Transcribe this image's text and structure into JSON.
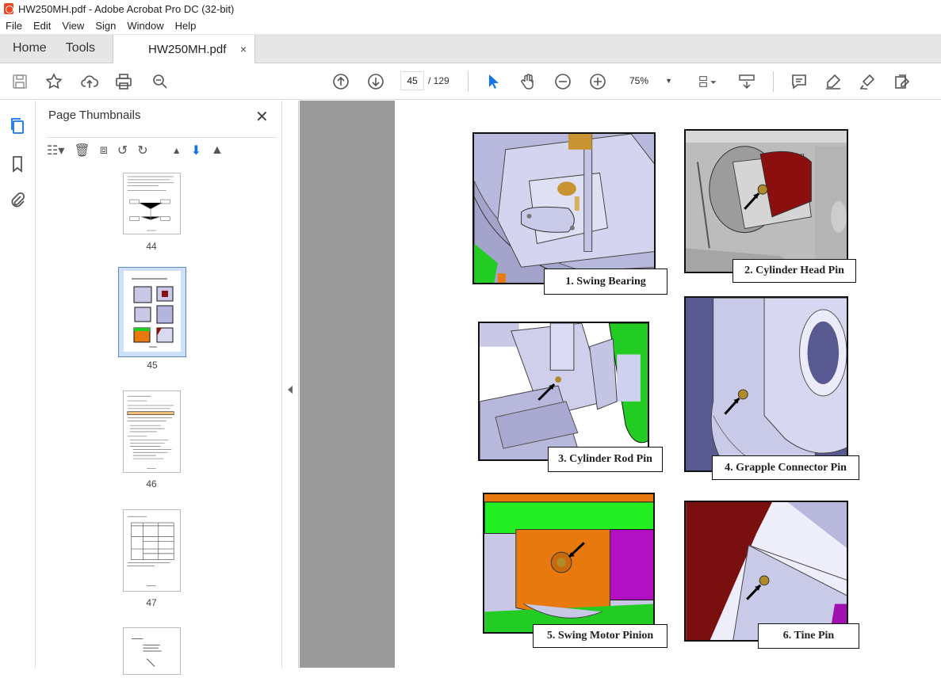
{
  "window": {
    "title": "HW250MH.pdf - Adobe Acrobat Pro DC (32-bit)"
  },
  "menu": [
    "File",
    "Edit",
    "View",
    "Sign",
    "Window",
    "Help"
  ],
  "tabs": {
    "home": "Home",
    "tools": "Tools",
    "document": "HW250MH.pdf",
    "close": "×"
  },
  "toolbar": {
    "current_page": "45",
    "page_of": "/ 129",
    "zoom": "75%"
  },
  "thumbnails": {
    "title": "Page Thumbnails",
    "pages": [
      {
        "label": "44"
      },
      {
        "label": "45",
        "selected": true
      },
      {
        "label": "46"
      },
      {
        "label": "47"
      },
      {
        "label": ""
      }
    ]
  },
  "document": {
    "captions": [
      "1. Swing Bearing",
      "2. Cylinder Head Pin",
      "3. Cylinder Rod Pin",
      "4. Grapple Connector Pin",
      "5. Swing Motor Pinion",
      "6. Tine Pin"
    ]
  },
  "colors": {
    "accent": "#1473e6",
    "viewer_bg": "#9b9b9b",
    "part_lavender": "#c8c8e6",
    "part_green": "#22cc22",
    "part_orange": "#e8790f",
    "part_red": "#8b0f0f",
    "part_purple": "#a010b0"
  }
}
